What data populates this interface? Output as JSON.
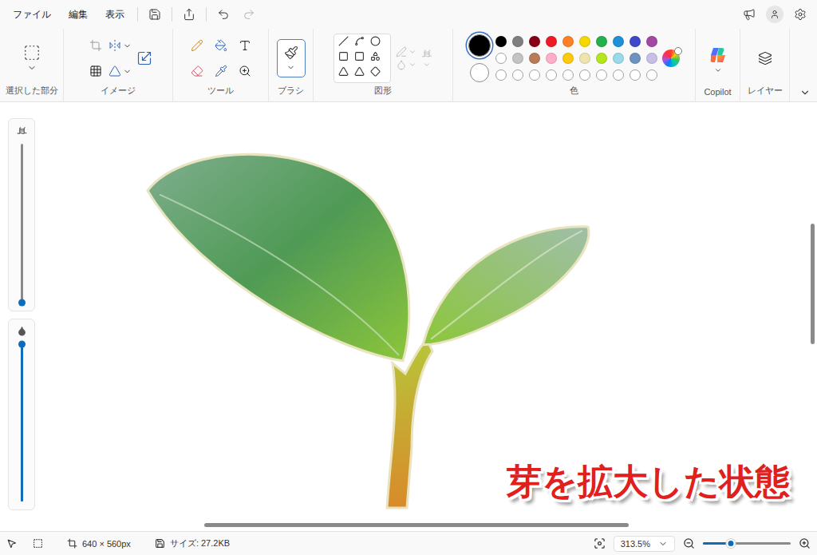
{
  "menu": [
    {
      "label": "ファイル"
    },
    {
      "label": "編集"
    },
    {
      "label": "表示"
    }
  ],
  "ribbon": {
    "groups": [
      {
        "label": "選択した部分"
      },
      {
        "label": "イメージ"
      },
      {
        "label": "ツール"
      },
      {
        "label": "ブラシ"
      },
      {
        "label": "図形"
      },
      {
        "label": "色"
      },
      {
        "label": "Copilot"
      },
      {
        "label": "レイヤー"
      }
    ],
    "brush": {
      "selected": true
    }
  },
  "colors": {
    "primary": "#000000",
    "secondary": "#ffffff",
    "palette": [
      {
        "kind": "swatch",
        "color": "#000000"
      },
      {
        "kind": "swatch",
        "color": "#7f7f7f"
      },
      {
        "kind": "swatch",
        "color": "#880015"
      },
      {
        "kind": "swatch",
        "color": "#ed1c24"
      },
      {
        "kind": "swatch",
        "color": "#ff7f27"
      },
      {
        "kind": "swatch",
        "color": "#f5d800"
      },
      {
        "kind": "swatch",
        "color": "#22b14c"
      },
      {
        "kind": "swatch",
        "color": "#1e90d6"
      },
      {
        "kind": "swatch",
        "color": "#3f48cc"
      },
      {
        "kind": "swatch",
        "color": "#a349a4"
      },
      {
        "kind": "empty"
      },
      {
        "kind": "swatch",
        "color": "#c3c3c3"
      },
      {
        "kind": "swatch",
        "color": "#b97a57"
      },
      {
        "kind": "swatch",
        "color": "#ffaec9"
      },
      {
        "kind": "swatch",
        "color": "#ffc90e"
      },
      {
        "kind": "swatch",
        "color": "#efe4b0"
      },
      {
        "kind": "swatch",
        "color": "#b5e61d"
      },
      {
        "kind": "swatch",
        "color": "#99d9ea"
      },
      {
        "kind": "swatch",
        "color": "#7092be"
      },
      {
        "kind": "swatch",
        "color": "#c8bfe7"
      },
      {
        "kind": "empty"
      },
      {
        "kind": "empty"
      },
      {
        "kind": "empty"
      },
      {
        "kind": "empty"
      },
      {
        "kind": "empty"
      },
      {
        "kind": "empty"
      },
      {
        "kind": "empty"
      },
      {
        "kind": "empty"
      },
      {
        "kind": "empty"
      },
      {
        "kind": "empty"
      }
    ]
  },
  "size_slider": {
    "level": 0
  },
  "opacity_slider": {
    "level": 1
  },
  "canvas": {
    "annotation": "芽を拡大した状態"
  },
  "scrollbars": {
    "horizontal": {
      "start": 0.25,
      "size": 0.52
    },
    "vertical": {
      "start": 0.29,
      "size": 0.29
    }
  },
  "status_bar": {
    "dimensions": "640 × 560px",
    "size": "サイズ: 27.2KB",
    "zoom": "313.5%",
    "zoom_level": 0.32
  }
}
